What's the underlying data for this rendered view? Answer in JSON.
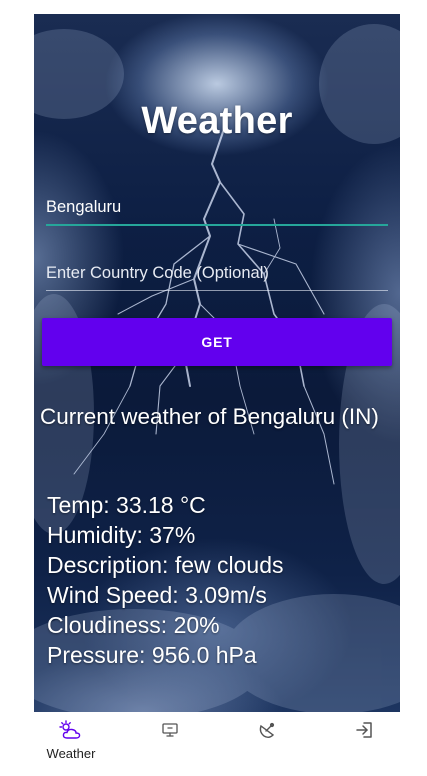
{
  "app": {
    "title": "Weather"
  },
  "form": {
    "city_value": "Bengaluru",
    "country_placeholder": "Enter Country Code (Optional)",
    "get_label": "GET"
  },
  "result": {
    "heading": "Current weather of Bengaluru (IN)",
    "temp": "Temp: 33.18 °C",
    "humidity": "Humidity: 37%",
    "description": "Description: few clouds",
    "wind": "Wind Speed: 3.09m/s",
    "cloudiness": "Cloudiness: 20%",
    "pressure": "Pressure: 956.0 hPa"
  },
  "nav": {
    "items": [
      {
        "label": "Weather",
        "icon": "weather-icon",
        "active": true
      },
      {
        "label": "",
        "icon": "screen-icon",
        "active": false
      },
      {
        "label": "",
        "icon": "satellite-dish-icon",
        "active": false
      },
      {
        "label": "",
        "icon": "exit-icon",
        "active": false
      }
    ]
  },
  "colors": {
    "button": "#6200ee",
    "active_underline": "#26a69a",
    "icon_accent": "#6200ee"
  }
}
